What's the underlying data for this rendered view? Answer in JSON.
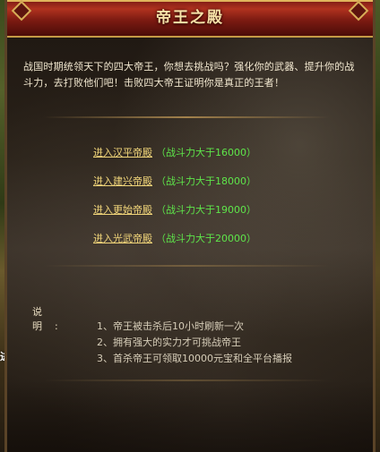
{
  "window": {
    "title": "帝王之殿"
  },
  "intro": {
    "text": "战国时期统领天下的四大帝王，你想去挑战吗？强化你的武器、提升你的战斗力，去打败他们吧！击败四大帝王证明你是真正的王者！"
  },
  "palaces": [
    {
      "label": "进入汉平帝殿",
      "requirement": "（战斗力大于16000）"
    },
    {
      "label": "进入建兴帝殿",
      "requirement": "（战斗力大于18000）"
    },
    {
      "label": "进入更始帝殿",
      "requirement": "（战斗力大于19000）"
    },
    {
      "label": "进入光武帝殿",
      "requirement": "（战斗力大于20000）"
    }
  ],
  "notes": {
    "label": "说明:",
    "items": [
      "1、帝王被击杀后10小时刷新一次",
      "2、拥有强大的实力才可挑战帝王",
      "3、首杀帝王可领取10000元宝和全平台播报"
    ]
  },
  "side_text": "进",
  "colors": {
    "title_red": "#b0321f",
    "title_gold": "#f7e2a8",
    "link_gold": "#f2d67a",
    "requirement_green": "#5ee64a",
    "text_light": "#f2e8d0"
  }
}
